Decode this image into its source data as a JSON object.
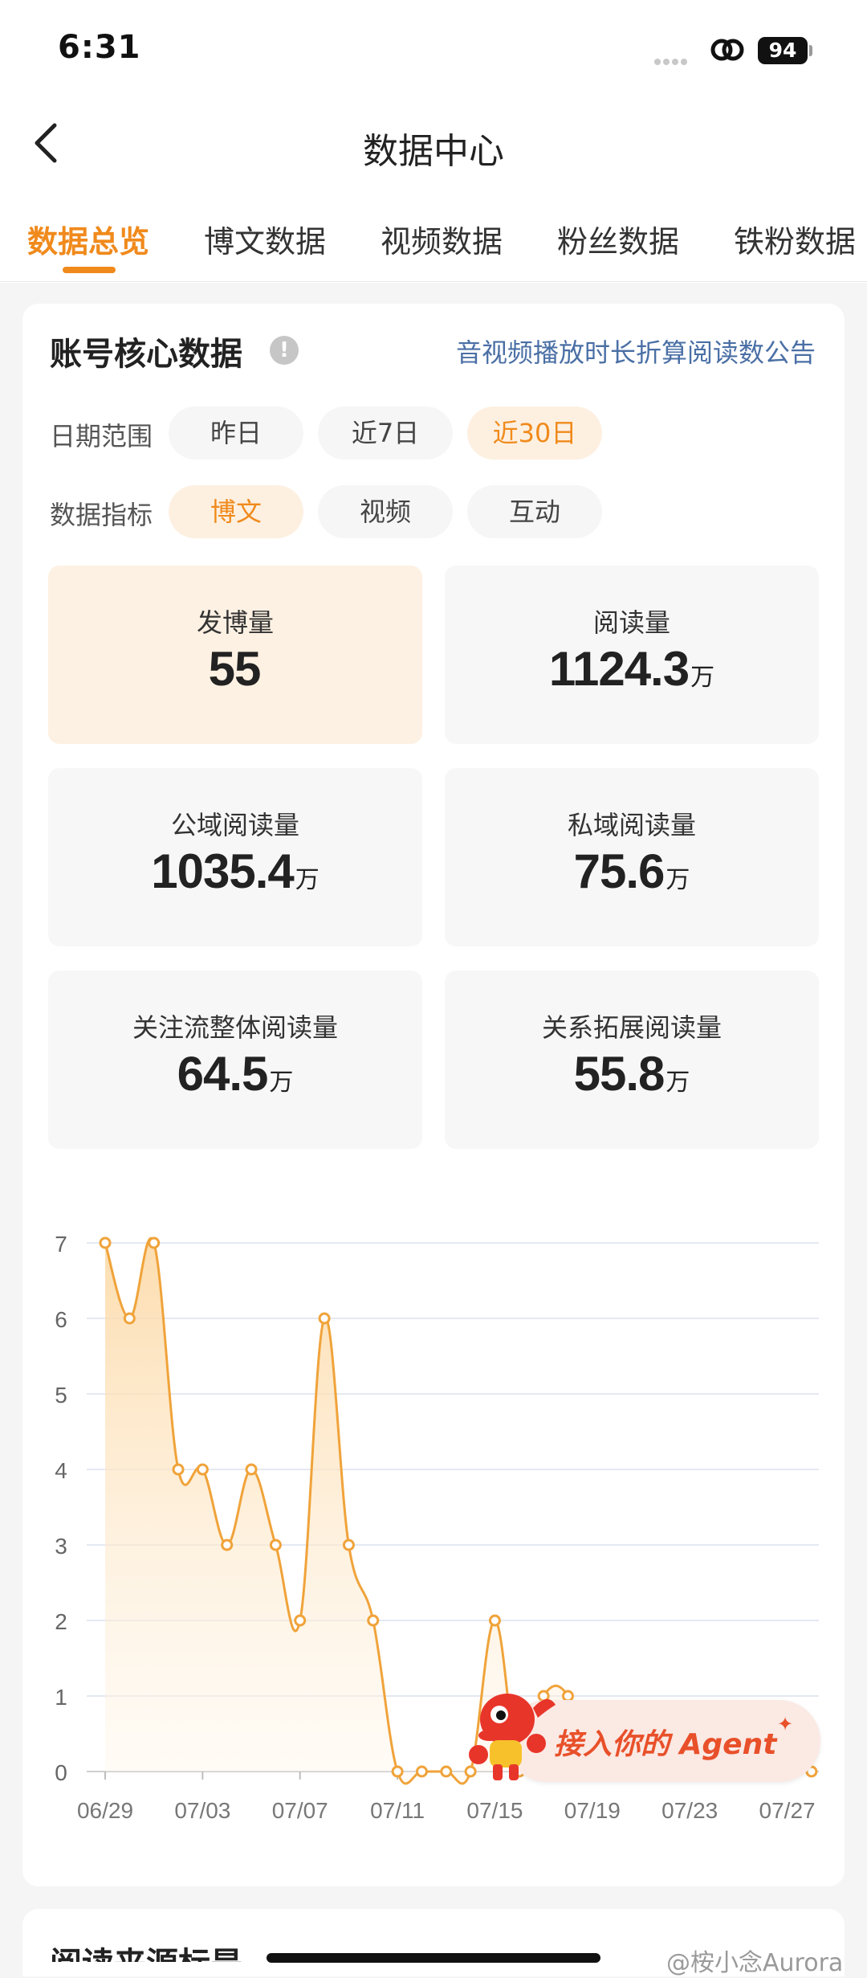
{
  "status_bar": {
    "time": "6:31",
    "battery": "94"
  },
  "nav": {
    "title": "数据中心"
  },
  "tabs": [
    {
      "label": "数据总览",
      "active": true
    },
    {
      "label": "博文数据",
      "active": false
    },
    {
      "label": "视频数据",
      "active": false
    },
    {
      "label": "粉丝数据",
      "active": false
    },
    {
      "label": "铁粉数据",
      "active": false
    }
  ],
  "core": {
    "title": "账号核心数据",
    "info_glyph": "!",
    "notice_link": "音视频播放时长折算阅读数公告",
    "date_range": {
      "label": "日期范围",
      "options": [
        "昨日",
        "近7日",
        "近30日"
      ],
      "selected": "近30日"
    },
    "metric": {
      "label": "数据指标",
      "options": [
        "博文",
        "视频",
        "互动"
      ],
      "selected": "博文"
    },
    "stats": [
      {
        "label": "发博量",
        "value": "55",
        "unit": "",
        "active": true
      },
      {
        "label": "阅读量",
        "value": "1124.3",
        "unit": "万",
        "active": false
      },
      {
        "label": "公域阅读量",
        "value": "1035.4",
        "unit": "万",
        "active": false
      },
      {
        "label": "私域阅读量",
        "value": "75.6",
        "unit": "万",
        "active": false
      },
      {
        "label": "关注流整体阅读量",
        "value": "64.5",
        "unit": "万",
        "active": false
      },
      {
        "label": "关系拓展阅读量",
        "value": "55.8",
        "unit": "万",
        "active": false
      }
    ]
  },
  "chart_data": {
    "type": "area",
    "x": [
      "06/29",
      "06/30",
      "07/01",
      "07/02",
      "07/03",
      "07/04",
      "07/05",
      "07/06",
      "07/07",
      "07/08",
      "07/09",
      "07/10",
      "07/11",
      "07/12",
      "07/13",
      "07/14",
      "07/15",
      "07/16",
      "07/17",
      "07/18",
      "07/19",
      "07/20",
      "07/21",
      "07/22",
      "07/23",
      "07/24",
      "07/25",
      "07/26",
      "07/27",
      "07/28"
    ],
    "values": [
      7,
      6,
      7,
      4,
      4,
      3,
      4,
      3,
      2,
      6,
      3,
      2,
      0,
      0,
      0,
      0,
      2,
      0,
      1,
      1,
      0,
      0,
      0,
      0,
      0,
      0,
      0,
      0,
      0,
      0
    ],
    "x_tick_labels": [
      "06/29",
      "07/03",
      "07/07",
      "07/11",
      "07/15",
      "07/19",
      "07/23",
      "07/27"
    ],
    "y_ticks": [
      0,
      1,
      2,
      3,
      4,
      5,
      6,
      7
    ],
    "ylim": [
      0,
      7
    ],
    "title": "",
    "xlabel": "",
    "ylabel": "",
    "grid": true,
    "colors": {
      "line": "#f0a33a",
      "fill": "#fde3bf",
      "point_fill": "#ffffff"
    }
  },
  "agent_banner": {
    "text": "接入你的 Agent",
    "star": "✦"
  },
  "next_section": {
    "title": "阅读来源标是"
  },
  "watermark": "@桉小念Aurora"
}
